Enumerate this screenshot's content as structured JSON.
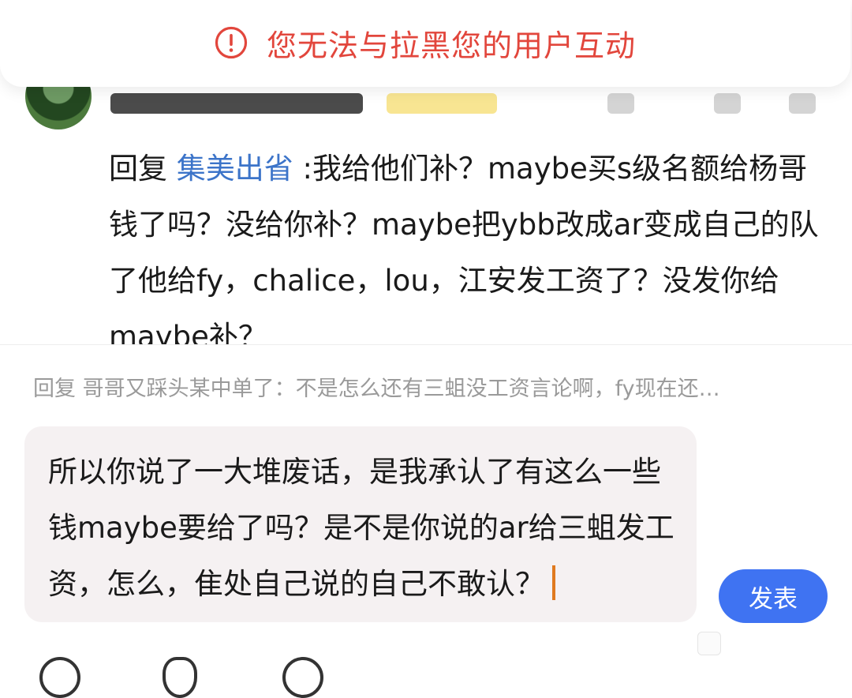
{
  "toast": {
    "message": "您无法与拉黑您的用户互动",
    "color": "#e2463c"
  },
  "comment": {
    "reply_prefix": "回复",
    "mention": "集美出省",
    "body": ":我给他们补？maybe买s级名额给杨哥钱了吗？没给你补？maybe把ybb改成ar变成自己的队了他给fy，chalice，lou，江安发工资了？没发你给maybe补？",
    "mention_color": "#3c74c9"
  },
  "reply_hint": {
    "text": "回复 哥哥又踩头某中单了：不是怎么还有三蛆没工资言论啊，fy现在还…"
  },
  "input": {
    "value": "所以你说了一大堆废话，是我承认了有这么一些钱maybe要给了吗？是不是你说的ar给三蛆发工资，怎么，隹处自己说的自己不敢认？"
  },
  "send_button": {
    "label": "发表",
    "color": "#3f73f2"
  },
  "icons": [
    "warning-icon",
    "avatar",
    "image-icon",
    "emoji-icon",
    "mention-icon",
    "topic-icon"
  ]
}
